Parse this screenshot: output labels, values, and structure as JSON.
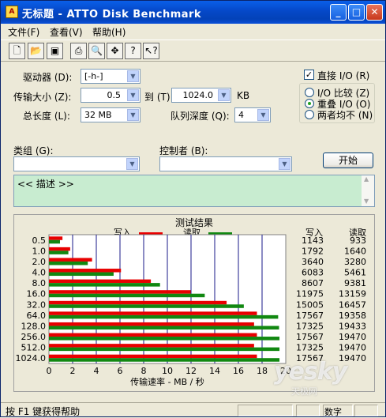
{
  "window": {
    "title": "无标题 - ATTO Disk Benchmark",
    "minimize": "_",
    "maximize": "□",
    "close": "✕"
  },
  "menu": [
    "文件(F)",
    "查看(V)",
    "帮助(H)"
  ],
  "toolbar": {
    "icons": [
      "new-icon",
      "open-icon",
      "save-icon",
      "print-icon",
      "print-preview-icon",
      "move-icon",
      "help-icon",
      "context-help-icon"
    ]
  },
  "form": {
    "drive_label": "驱动器 (D):",
    "drive_value": "[-h-]",
    "transfer_label": "传输大小 (Z):",
    "transfer_from": "0.5",
    "to_label": "到 (T)",
    "transfer_to": "1024.0",
    "unit": "KB",
    "length_label": "总长度 (L):",
    "length_value": "32 MB",
    "queue_label": "队列深度 (Q):",
    "queue_value": "4",
    "direct_io": "直接 I/O (R)",
    "direct_io_checked": true,
    "io_compare": "I/O 比较 (Z)",
    "overlap_io": "重叠 I/O (O)",
    "neither": "两者均不 (N)",
    "selected_io": "overlap_io",
    "category_label": "类组 (G):",
    "controller_label": "控制者 (B):",
    "start_button": "开始",
    "description": "<< 描述 >>"
  },
  "results": {
    "title": "测试结果",
    "write_legend": "写入",
    "read_legend": "读取",
    "write_header": "写入",
    "read_header": "读取",
    "xlabel": "传输速率 - MB / 秒",
    "write_color": "#e80000",
    "read_color": "#118811"
  },
  "chart_data": {
    "type": "bar",
    "orientation": "horizontal",
    "title": "测试结果",
    "xlabel": "传输速率 - MB / 秒",
    "xlim": [
      0,
      20
    ],
    "xticks": [
      "0",
      "2",
      "4",
      "6",
      "8",
      "10",
      "12",
      "14",
      "16",
      "18",
      "20"
    ],
    "categories": [
      "0.5",
      "1.0",
      "2.0",
      "4.0",
      "8.0",
      "16.0",
      "32.0",
      "64.0",
      "128.0",
      "256.0",
      "512.0",
      "1024.0"
    ],
    "series": [
      {
        "name": "写入",
        "values": [
          1.143,
          1.792,
          3.64,
          6.083,
          8.607,
          11.975,
          15.005,
          17.567,
          17.325,
          17.567,
          17.325,
          17.567
        ],
        "labels": [
          "1143",
          "1792",
          "3640",
          "6083",
          "8607",
          "11975",
          "15005",
          "17567",
          "17325",
          "17567",
          "17325",
          "17567"
        ],
        "color": "#e80000"
      },
      {
        "name": "读取",
        "values": [
          0.933,
          1.64,
          3.28,
          5.461,
          9.381,
          13.159,
          16.457,
          19.358,
          19.433,
          19.47,
          19.47,
          19.47
        ],
        "labels": [
          "933",
          "1640",
          "3280",
          "5461",
          "9381",
          "13159",
          "16457",
          "19358",
          "19433",
          "19470",
          "19470",
          "19470"
        ],
        "color": "#118811"
      }
    ]
  },
  "status": {
    "help": "按 F1 键获得帮助",
    "num": "数字"
  },
  "watermark": {
    "logo": "yesky",
    "sub": "天极网"
  }
}
